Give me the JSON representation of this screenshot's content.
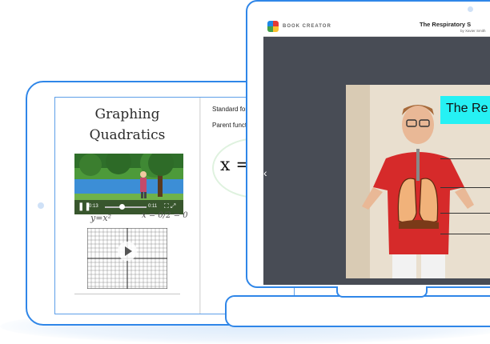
{
  "tablet": {
    "page_title": "Graphing\nQuadratics",
    "video": {
      "play_symbol": "❚❚",
      "time_elapsed": "0:13",
      "time_total": "0:11",
      "progress": 0.4
    },
    "math_note_left": "y=x²",
    "math_note_right": "x = 0/2 = 0",
    "right_text_1": "Standard for",
    "right_text_2": "Parent funct",
    "big_math": "x = -"
  },
  "laptop": {
    "brand": "BOOK CREATOR",
    "book_title": "The Respiratory S",
    "book_author": "by Xavier Smith",
    "slide_title": "The Re",
    "prev_arrow": "‹"
  },
  "colors": {
    "device_outline": "#2f86e8",
    "stage_bg": "#484c55",
    "slide_title_bg": "#26f1f4"
  }
}
